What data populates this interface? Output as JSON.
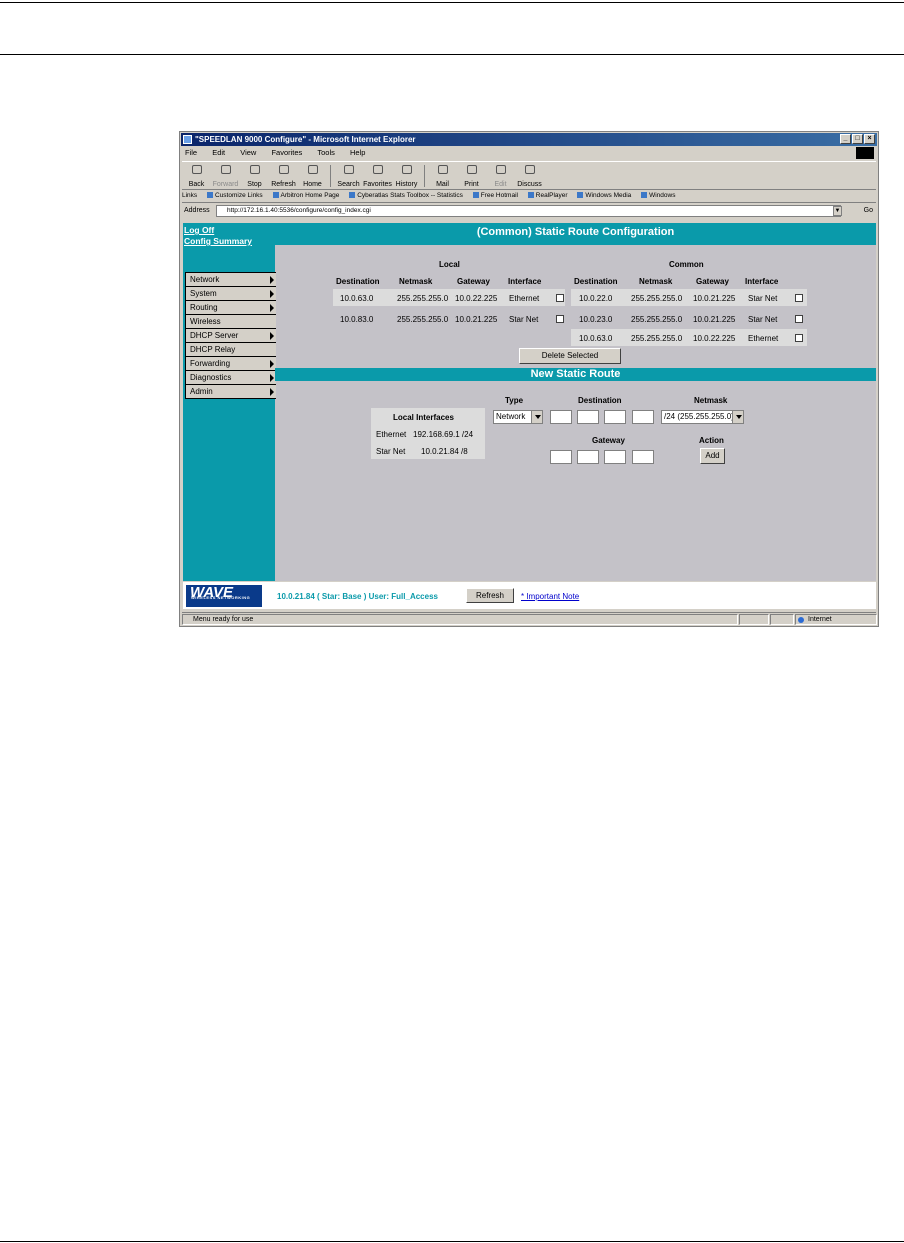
{
  "window": {
    "title": "\"SPEEDLAN 9000 Configure\" - Microsoft Internet Explorer",
    "controls": [
      "_",
      "□",
      "×"
    ]
  },
  "menubar": [
    "File",
    "Edit",
    "View",
    "Favorites",
    "Tools",
    "Help"
  ],
  "toolbar": [
    {
      "label": "Back",
      "icon": "back-arrow-icon"
    },
    {
      "label": "Forward",
      "icon": "forward-arrow-icon",
      "disabled": true
    },
    {
      "label": "Stop",
      "icon": "stop-icon"
    },
    {
      "label": "Refresh",
      "icon": "refresh-icon"
    },
    {
      "label": "Home",
      "icon": "home-icon"
    },
    {
      "label": "Search",
      "icon": "search-icon"
    },
    {
      "label": "Favorites",
      "icon": "favorites-icon"
    },
    {
      "label": "History",
      "icon": "history-icon"
    },
    {
      "label": "Mail",
      "icon": "mail-icon"
    },
    {
      "label": "Print",
      "icon": "print-icon"
    },
    {
      "label": "Edit",
      "icon": "edit-icon",
      "disabled": true
    },
    {
      "label": "Discuss",
      "icon": "discuss-icon"
    }
  ],
  "links": {
    "label": "Links",
    "items": [
      "Customize Links",
      "Arbitron Home Page",
      "Cyberatlas Stats Toolbox -- Statistics",
      "Free Hotmail",
      "RealPlayer",
      "Windows Media",
      "Windows"
    ]
  },
  "address": {
    "label": "Address",
    "url": "http://172.16.1.40:5536/configure/config_index.cgi",
    "go": "Go"
  },
  "sidebar": {
    "log_off": "Log Off",
    "config_summary": "Config Summary",
    "menu": [
      {
        "label": "Network",
        "arrow": true
      },
      {
        "label": "System",
        "arrow": true
      },
      {
        "label": "Routing",
        "arrow": true
      },
      {
        "label": "Wireless",
        "arrow": false
      },
      {
        "label": "DHCP Server",
        "arrow": true
      },
      {
        "label": "DHCP Relay",
        "arrow": false
      },
      {
        "label": "Forwarding",
        "arrow": true
      },
      {
        "label": "Diagnostics",
        "arrow": true
      },
      {
        "label": "Admin",
        "arrow": true
      }
    ]
  },
  "static_route": {
    "title": "(Common) Static Route Configuration",
    "local_heading": "Local",
    "common_heading": "Common",
    "columns": [
      "Destination",
      "Netmask",
      "Gateway",
      "Interface"
    ],
    "local_rows": [
      [
        "10.0.63.0",
        "255.255.255.0",
        "10.0.22.225",
        "Ethernet"
      ],
      [
        "10.0.83.0",
        "255.255.255.0",
        "10.0.21.225",
        "Star Net"
      ]
    ],
    "common_rows": [
      [
        "10.0.22.0",
        "255.255.255.0",
        "10.0.21.225",
        "Star Net"
      ],
      [
        "10.0.23.0",
        "255.255.255.0",
        "10.0.21.225",
        "Star Net"
      ],
      [
        "10.0.63.0",
        "255.255.255.0",
        "10.0.22.225",
        "Ethernet"
      ]
    ],
    "delete_button": "Delete Selected"
  },
  "new_route": {
    "title": "New Static Route",
    "local_interfaces_heading": "Local Interfaces",
    "interfaces": [
      {
        "name": "Ethernet",
        "address": "192.168.69.1 /24"
      },
      {
        "name": "Star Net",
        "address": "10.0.21.84 /8"
      }
    ],
    "type_label": "Type",
    "type_value": "Network",
    "destination_label": "Destination",
    "netmask_label": "Netmask",
    "netmask_value": "/24 (255.255.255.0)",
    "gateway_label": "Gateway",
    "action_label": "Action",
    "add_button": "Add"
  },
  "footer": {
    "logo": "WAVE",
    "logo_sub": "WIRELESS NETWORKING",
    "status": "10.0.21.84 ( Star: Base ) User: Full_Access",
    "refresh_button": "Refresh",
    "note_link": "* Important Note"
  },
  "statusbar": {
    "text": "Menu ready for use",
    "zone": "Internet"
  }
}
